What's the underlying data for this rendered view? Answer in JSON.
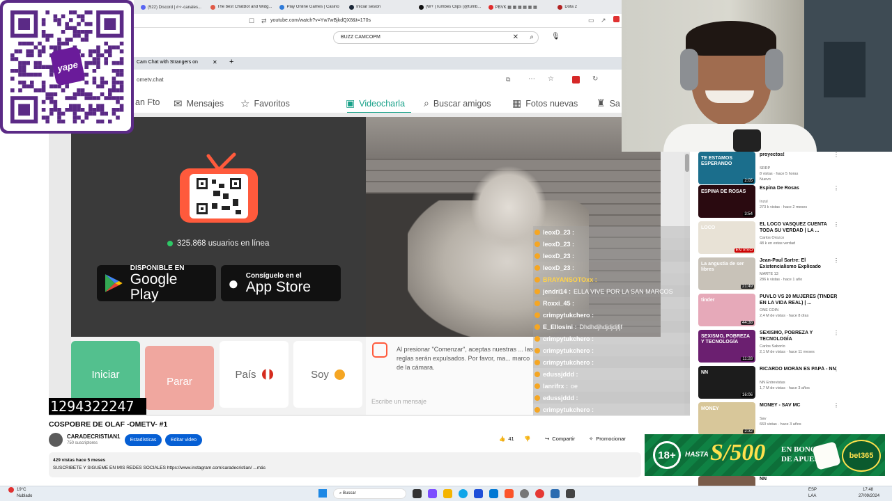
{
  "browser": {
    "tabs": [
      {
        "label": "(522) Discord | #✧-canales...",
        "color": "#5865f2"
      },
      {
        "label": "The best ChatBot and Widg...",
        "color": "#e05a47"
      },
      {
        "label": "Play Online Games | Casino",
        "color": "#2f7bd9"
      },
      {
        "label": "Iniciar sesión",
        "color": "#1b2838"
      },
      {
        "label": "(W+ (Tumbes Clips (@tumb...",
        "color": "#111111"
      },
      {
        "label": "PBVK ▦ ▦ ▦ ▦ ▦ ▦",
        "color": "#e02b2b"
      },
      {
        "label": "Dota 2",
        "color": "#b22222"
      }
    ],
    "url": "youtube.com/watch?v=Yw7wBjkdQX8&t=170s",
    "search_value": "BUZZ CAMCOPM"
  },
  "inner_browser": {
    "tab_label": "Cam Chat with Strangers on",
    "url": "ometv.chat"
  },
  "ometv": {
    "nav": {
      "partial": "an Fto",
      "messages": "Mensajes",
      "favorites": "Favoritos",
      "videochat": "Videocharla",
      "find_friends": "Buscar amigos",
      "new_photos": "Fotos nuevas",
      "sa": "Sa"
    },
    "online_count": "325.868 usuarios en línea",
    "google_play": {
      "small": "DISPONIBLE EN",
      "big": "Google Play"
    },
    "app_store": {
      "small": "Consíguelo en el",
      "big": "App Store"
    },
    "buttons": {
      "start": "Iniciar",
      "stop": "Parar",
      "country": "País",
      "gender": "Soy"
    },
    "notice": "Al presionar \"Comenzar\", aceptas nuestras ... las reglas serán expulsados. Por favor, ma... marco de la cámara.",
    "message_placeholder": "Escribe un mensaje",
    "chat": [
      {
        "user": "leoxD_23 :",
        "msg": "",
        "color": "#ffffff"
      },
      {
        "user": "leoxD_23 :",
        "msg": "",
        "color": "#ffffff"
      },
      {
        "user": "leoxD_23 :",
        "msg": "",
        "color": "#ffffff"
      },
      {
        "user": "leoxD_23 :",
        "msg": "",
        "color": "#ffffff"
      },
      {
        "user": "BRAYANSOTOxx :",
        "msg": "",
        "color": "#ffd24a"
      },
      {
        "user": "jendri14 :",
        "msg": "ELLA VIVE POR LA SAN MARCOS",
        "color": "#ffffff"
      },
      {
        "user": "Roxxi_45 :",
        "msg": "",
        "color": "#ffffff"
      },
      {
        "user": "crimpytukchero :",
        "msg": "",
        "color": "#ffffff"
      },
      {
        "user": "E_Ellosini :",
        "msg": "Dhdhdjhdjdjdjfjf",
        "color": "#ffffff"
      },
      {
        "user": "crimpytukchero :",
        "msg": "",
        "color": "#ffffff"
      },
      {
        "user": "crimpytukchero :",
        "msg": "",
        "color": "#ffffff"
      },
      {
        "user": "crimpytukchero :",
        "msg": "",
        "color": "#ffffff"
      },
      {
        "user": "edussjddd :",
        "msg": "",
        "color": "#ffffff"
      },
      {
        "user": "lanrifrx :",
        "msg": "oe",
        "color": "#ffffff"
      },
      {
        "user": "edussjddd :",
        "msg": "",
        "color": "#ffffff"
      },
      {
        "user": "crimpytukchero :",
        "msg": "",
        "color": "#ffffff"
      }
    ]
  },
  "counter": "1294322247",
  "video": {
    "title": "COSPOBRE DE OLAF -OMETV- #1",
    "channel": "CARADECRISTIAN1",
    "subs": "750 suscriptores",
    "btn_stats": "Estadísticas",
    "btn_edit": "Editar video",
    "likes": "41",
    "share": "Compartir",
    "promote": "Promocionar",
    "desc_line1": "429 vistas  hace 5 meses",
    "desc_line2": "SUSCRIBETE Y SIGUEME EN MIS REDES SOCIALES https://www.instagram.com/caradecristian/ ...más"
  },
  "qr_brand": "yape",
  "sidebar": [
    {
      "title": "proyectos!",
      "channel": "SRRP",
      "meta": "8 vistas · hace 5 horas",
      "badge": "Nuevo",
      "dur": "2:05",
      "thumb": "#1b6e8c",
      "thumb_text": "TE ESTAMOS ESPERANDO"
    },
    {
      "title": "Espina De Rosas",
      "channel": "Inzul",
      "meta": "273 k vistas · hace 2 meses",
      "badge": "",
      "dur": "3:54",
      "thumb": "#2a0a10",
      "thumb_text": "ESPINA DE ROSAS"
    },
    {
      "title": "EL LOCO VASQUEZ CUENTA TODA SU VERDAD | LA ...",
      "channel": "Carlos Orozco",
      "meta": "48 k en estas verdad",
      "badge": "",
      "dur": "EN VIVO",
      "thumb": "#e8e2d6",
      "thumb_text": "LOCO"
    },
    {
      "title": "Jean-Paul Sartre: El Existencialismo Explicado",
      "channel": "MARTE 13",
      "meta": "286 k vistas · hace 1 año",
      "badge": "",
      "dur": "21:49",
      "thumb": "#c8c2b8",
      "thumb_text": "La angustia de ser libres"
    },
    {
      "title": "PUVLO VS 20 MUJERES (TINDER EN LA VIDA REAL) | ...",
      "channel": "ONE COIN",
      "meta": "2,4 M de vistas · hace 8 días",
      "badge": "",
      "dur": "44:38",
      "thumb": "#e6a9b9",
      "thumb_text": "tinder"
    },
    {
      "title": "SEXISMO, POBREZA Y TECNOLOGÍA",
      "channel": "Carlos Saborío",
      "meta": "2,1 M de vistas · hace 11 meses",
      "badge": "",
      "dur": "11:28",
      "thumb": "#6b1f70",
      "thumb_text": "SEXISMO, POBREZA Y TECNOLOGÍA"
    },
    {
      "title": "RICARDO MORÁN ES PAPÁ - NN",
      "channel": "NN Entrevistas",
      "meta": "1,7 M de vistas · hace 3 años",
      "badge": "",
      "dur": "16:06",
      "thumb": "#1c1c1c",
      "thumb_text": "NN"
    },
    {
      "title": "MONEY - SAV MC",
      "channel": "Sav",
      "meta": "660 vistas · hace 3 años",
      "badge": "",
      "dur": "2:32",
      "thumb": "#d8c79a",
      "thumb_text": "MONEY"
    },
    {
      "title": "NN",
      "channel": "",
      "meta": "",
      "badge": "",
      "dur": "",
      "thumb": "#7a5c4a",
      "thumb_text": ""
    }
  ],
  "bet_banner": {
    "age": "18+",
    "hasta": "HASTA",
    "amount": "S/500",
    "line1": "EN BONOS",
    "line2": "DE APUESTA",
    "brand": "bet365"
  },
  "taskbar": {
    "temp": "19°C",
    "weather": "Nublado",
    "search": "Buscar",
    "lang1": "ESP",
    "lang2": "LAA",
    "time": "17:48",
    "date": "27/09/2024"
  }
}
